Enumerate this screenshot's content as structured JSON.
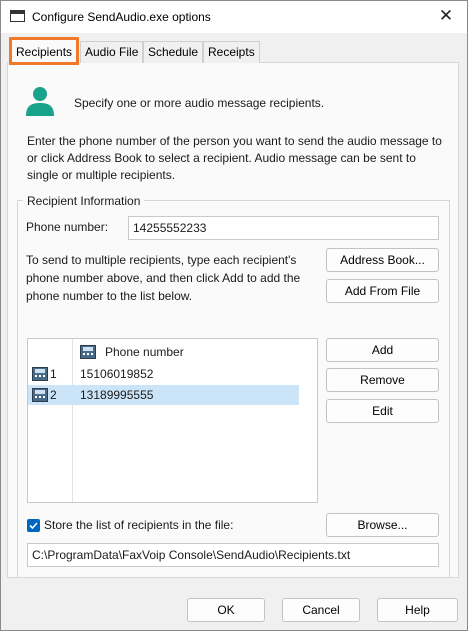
{
  "window": {
    "title": "Configure SendAudio.exe options",
    "close_glyph": "✕"
  },
  "tabs": [
    {
      "label": "Recipients",
      "active": true
    },
    {
      "label": "Audio File"
    },
    {
      "label": "Schedule"
    },
    {
      "label": "Receipts"
    }
  ],
  "intro": {
    "icon": "user-icon",
    "text": "Specify one or more audio message recipients.",
    "description": "Enter the phone number of the person you want to send the audio message to or click Address Book to select a recipient. Audio message can be sent to single or multiple recipients."
  },
  "recipient_info": {
    "group_label": "Recipient Information",
    "phone_label": "Phone number:",
    "phone_value": "14255552233",
    "multi_text": "To send to multiple recipients, type each recipient's phone number above, and then click Add to add the phone number to the list below.",
    "address_book_label": "Address Book...",
    "add_from_file_label": "Add From File"
  },
  "list": {
    "column_header": "Phone number",
    "rows": [
      {
        "index": "1",
        "number": "15106019852",
        "selected": false
      },
      {
        "index": "2",
        "number": "13189995555",
        "selected": true
      }
    ],
    "add_label": "Add",
    "remove_label": "Remove",
    "edit_label": "Edit"
  },
  "store": {
    "checked": true,
    "label": "Store the list of recipients in the file:",
    "browse_label": "Browse...",
    "path": "C:\\ProgramData\\FaxVoip Console\\SendAudio\\Recipients.txt"
  },
  "footer": {
    "ok_label": "OK",
    "cancel_label": "Cancel",
    "help_label": "Help"
  },
  "colors": {
    "accent": "#0067c0",
    "tab_highlight": "#f07a2a",
    "selection": "#cce4f7",
    "user_icon": "#1aa38c"
  }
}
